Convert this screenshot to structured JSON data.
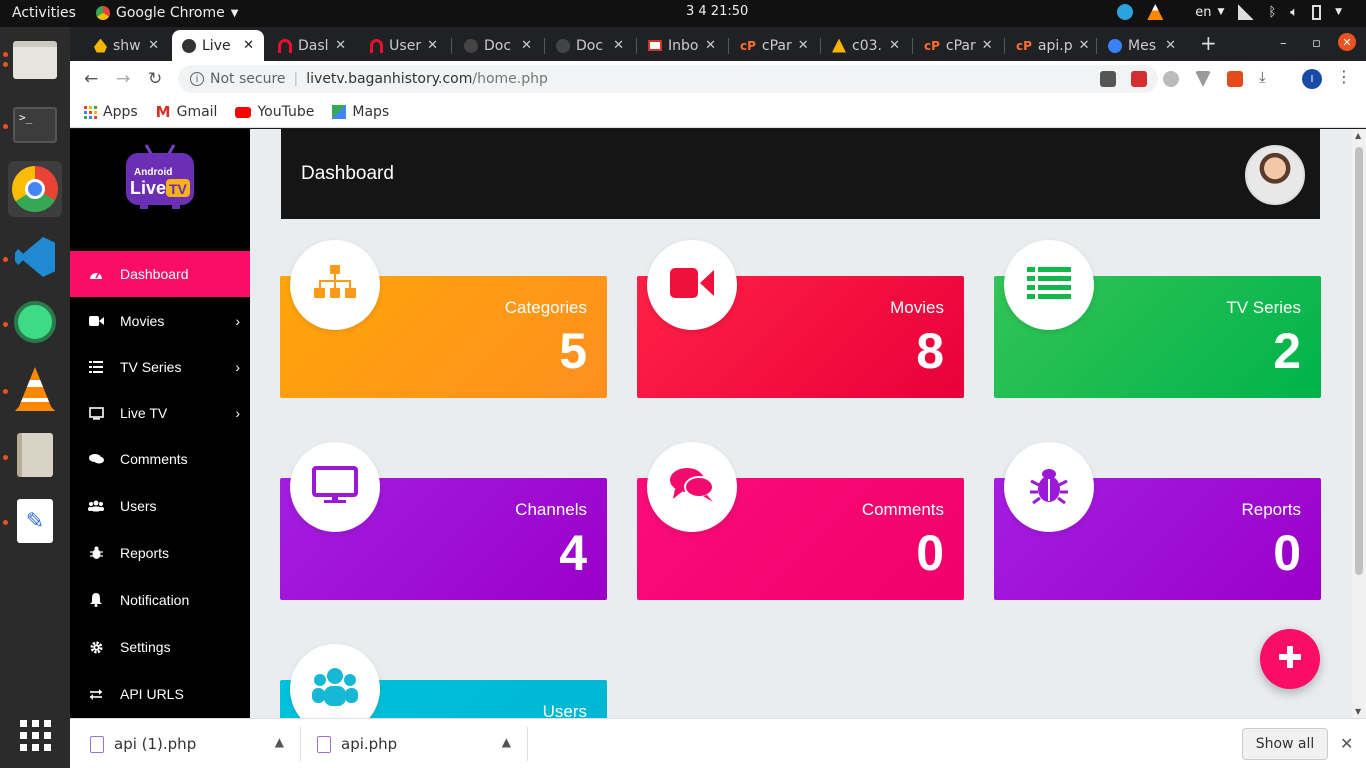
{
  "system": {
    "activities": "Activities",
    "app_name": "Google Chrome",
    "clock": "3 4  21:50",
    "lang": "en"
  },
  "tabs": [
    {
      "label": "shw",
      "icon": "fire-icon",
      "color": "#f4b400"
    },
    {
      "label": "Live",
      "icon": "globe-icon",
      "color": "#333"
    },
    {
      "label": "Dasl",
      "icon": "headphones-icon",
      "color": "#e8112d"
    },
    {
      "label": "User",
      "icon": "headphones-icon",
      "color": "#e8112d"
    },
    {
      "label": "Doc",
      "icon": "globe-icon",
      "color": "#666"
    },
    {
      "label": "Doc",
      "icon": "globe-icon",
      "color": "#666"
    },
    {
      "label": "Inbo",
      "icon": "gmail-icon",
      "color": "#d93025"
    },
    {
      "label": "cPar",
      "icon": "cpanel-icon",
      "color": "#ff6c2c"
    },
    {
      "label": "c03.",
      "icon": "cone-icon",
      "color": "#f4b400"
    },
    {
      "label": "cPar",
      "icon": "cpanel-icon",
      "color": "#ff6c2c"
    },
    {
      "label": "api.p",
      "icon": "cpanel-icon",
      "color": "#ff6c2c"
    },
    {
      "label": "Mes",
      "icon": "messenger-icon",
      "color": "#3b82f6"
    }
  ],
  "omnibox": {
    "security": "Not secure",
    "domain": "livetv.baganhistory.com",
    "path": "/home.php"
  },
  "bookmarks": [
    {
      "label": "Apps",
      "icon": "apps-grid-icon"
    },
    {
      "label": "Gmail",
      "icon": "gmail-icon"
    },
    {
      "label": "YouTube",
      "icon": "youtube-icon"
    },
    {
      "label": "Maps",
      "icon": "maps-icon"
    }
  ],
  "sidebar": {
    "logo_line1": "Android",
    "logo_line2": "Live",
    "logo_badge": "TV",
    "items": [
      {
        "label": "Dashboard",
        "icon": "dashboard-icon",
        "active": true,
        "submenu": false
      },
      {
        "label": "Movies",
        "icon": "video-camera-icon",
        "active": false,
        "submenu": true
      },
      {
        "label": "TV Series",
        "icon": "list-icon",
        "active": false,
        "submenu": true
      },
      {
        "label": "Live TV",
        "icon": "monitor-icon",
        "active": false,
        "submenu": true
      },
      {
        "label": "Comments",
        "icon": "comments-icon",
        "active": false,
        "submenu": false
      },
      {
        "label": "Users",
        "icon": "users-icon",
        "active": false,
        "submenu": false
      },
      {
        "label": "Reports",
        "icon": "bug-icon",
        "active": false,
        "submenu": false
      },
      {
        "label": "Notification",
        "icon": "bell-icon",
        "active": false,
        "submenu": false
      },
      {
        "label": "Settings",
        "icon": "gear-icon",
        "active": false,
        "submenu": false
      },
      {
        "label": "API URLS",
        "icon": "exchange-icon",
        "active": false,
        "submenu": false
      }
    ]
  },
  "header": {
    "title": "Dashboard"
  },
  "cards": [
    {
      "label": "Categories",
      "value": "5",
      "icon": "sitemap-icon",
      "color_from": "#ffa50a",
      "color_to": "#ff8f1f",
      "icon_color": "#ff9a16"
    },
    {
      "label": "Movies",
      "value": "8",
      "icon": "video-camera-icon",
      "color_from": "#ff2146",
      "color_to": "#e8003a",
      "icon_color": "#f0103c"
    },
    {
      "label": "TV Series",
      "value": "2",
      "icon": "list-icon",
      "color_from": "#33c457",
      "color_to": "#00b34a",
      "icon_color": "#14b84a"
    },
    {
      "label": "Channels",
      "value": "4",
      "icon": "monitor-icon",
      "color_from": "#a41ee0",
      "color_to": "#9a00c8",
      "icon_color": "#9b18d6"
    },
    {
      "label": "Comments",
      "value": "0",
      "icon": "comments-icon",
      "color_from": "#fa0d7a",
      "color_to": "#f0006a",
      "icon_color": "#f20a6e"
    },
    {
      "label": "Reports",
      "value": "0",
      "icon": "bug-icon",
      "color_from": "#a41ee0",
      "color_to": "#9a00c8",
      "icon_color": "#9b18d6"
    },
    {
      "label": "Users",
      "value": "",
      "icon": "users-icon",
      "color_from": "#00c2dc",
      "color_to": "#00b4d0",
      "icon_color": "#17b8d6"
    }
  ],
  "downloads": {
    "items": [
      {
        "name": "api (1).php"
      },
      {
        "name": "api.php"
      }
    ],
    "show_all": "Show all"
  }
}
